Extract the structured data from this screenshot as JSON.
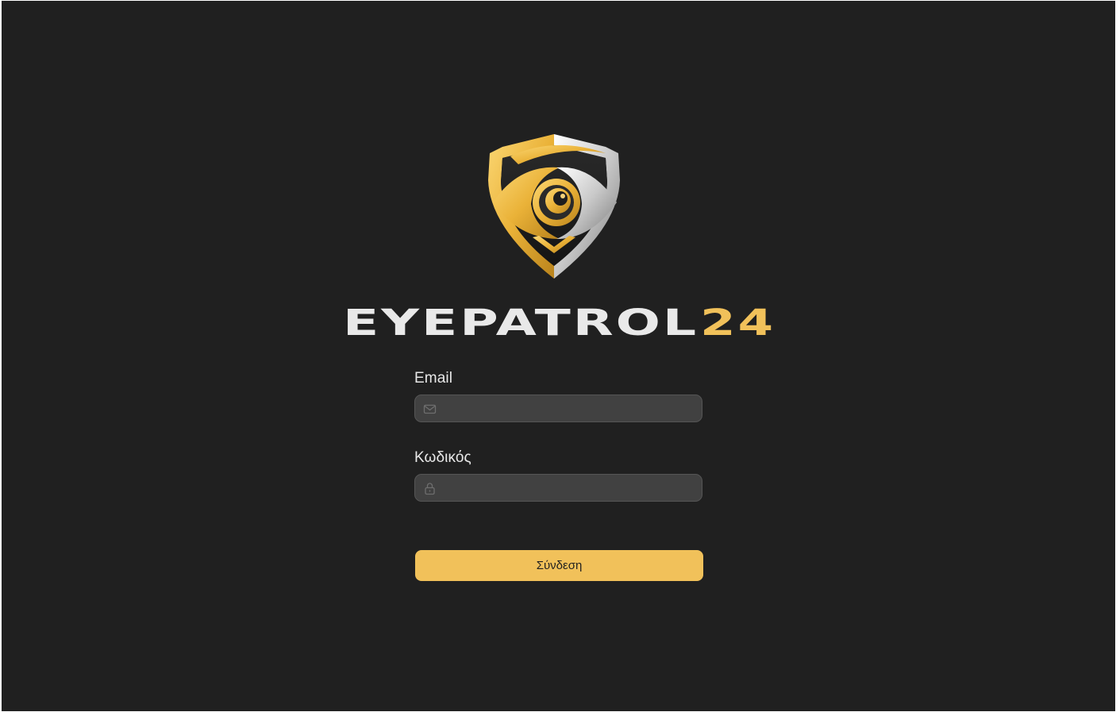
{
  "brand": {
    "name_main": "EYEPATROL",
    "name_accent": "24",
    "accent_color": "#f1c15a",
    "text_color": "#e9e9e9",
    "logo_icon": "shield-eye-logo"
  },
  "login_form": {
    "email": {
      "label": "Email",
      "value": "",
      "placeholder": "",
      "icon": "envelope-icon"
    },
    "password": {
      "label": "Κωδικός",
      "value": "",
      "placeholder": "",
      "icon": "lock-icon"
    },
    "submit_label": "Σύνδεση"
  },
  "colors": {
    "background": "#202020",
    "input_background": "#414141",
    "button_background": "#f1c15a"
  }
}
